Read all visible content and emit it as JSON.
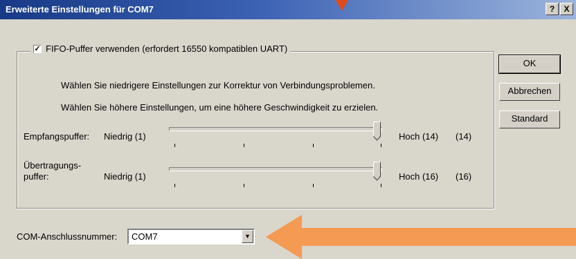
{
  "window": {
    "title": "Erweiterte Einstellungen für COM7",
    "help_btn": "?",
    "close_btn": "X"
  },
  "fifo": {
    "checked": true,
    "check_mark": "✓",
    "label": "FIFO-Puffer verwenden (erfordert 16550 kompatiblen UART)",
    "info_low": "Wählen Sie niedrigere Einstellungen zur Korrektur von Verbindungsproblemen.",
    "info_high": "Wählen Sie höhere Einstellungen, um eine höhere Geschwindigkeit zu erzielen."
  },
  "receive_buffer": {
    "label": "Empfangspuffer:",
    "min_label": "Niedrig (1)",
    "max_label": "Hoch (14)",
    "value_label": "(14)",
    "value_fraction": 1.0
  },
  "transmit_buffer": {
    "label_line1": "Übertragungs-",
    "label_line2": "puffer:",
    "min_label": "Niedrig (1)",
    "max_label": "Hoch (16)",
    "value_label": "(16)",
    "value_fraction": 1.0
  },
  "buttons": {
    "ok": "OK",
    "cancel": "Abbrechen",
    "standard": "Standard"
  },
  "com_port": {
    "label": "COM-Anschlussnummer:",
    "selected": "COM7",
    "dropdown_glyph": "▼"
  },
  "colors": {
    "annotation_arrow": "#f59a52",
    "top_marker": "#e24a1a",
    "title_gradient_start": "#183a86"
  }
}
